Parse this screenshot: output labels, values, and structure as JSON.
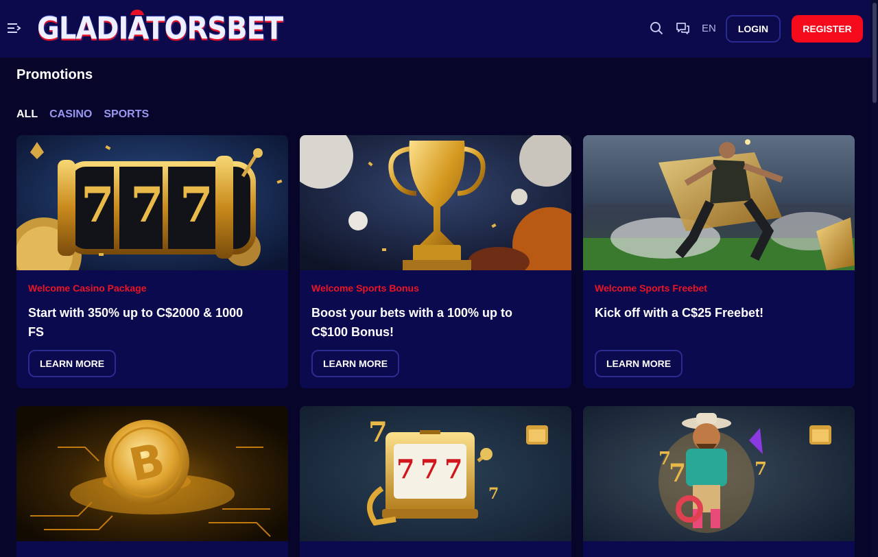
{
  "header": {
    "logo_text": "GLADIATORSBET",
    "language": "EN",
    "login_label": "LOGIN",
    "register_label": "REGISTER",
    "icons": [
      "menu-icon",
      "search-icon",
      "chat-icon"
    ]
  },
  "page": {
    "title": "Promotions",
    "tabs": [
      {
        "label": "ALL",
        "active": true
      },
      {
        "label": "CASINO",
        "active": false
      },
      {
        "label": "SPORTS",
        "active": false
      }
    ]
  },
  "promotions": [
    {
      "category": "Welcome Casino Package",
      "title": "Start with 350% up to C$2000 & 1000 FS",
      "button": "LEARN MORE",
      "image": "slot-777-reels"
    },
    {
      "category": "Welcome Sports Bonus",
      "title": "Boost your bets with a 100% up to C$100 Bonus!",
      "button": "LEARN MORE",
      "image": "gold-trophy-balls"
    },
    {
      "category": "Welcome Sports Freebet",
      "title": "Kick off with a C$25 Freebet!",
      "button": "LEARN MORE",
      "image": "footballer-golden-ticket"
    },
    {
      "category": "",
      "title": "",
      "button": "",
      "image": "bitcoin-coin"
    },
    {
      "category": "",
      "title": "",
      "button": "",
      "image": "slot-machine-777"
    },
    {
      "category": "",
      "title": "",
      "button": "",
      "image": "cowboy-character"
    }
  ],
  "colors": {
    "background": "#07062a",
    "header": "#0c0a4a",
    "card": "#0c0a4f",
    "accent_red": "#f50b1b",
    "tab_inactive": "#9b97f0"
  }
}
